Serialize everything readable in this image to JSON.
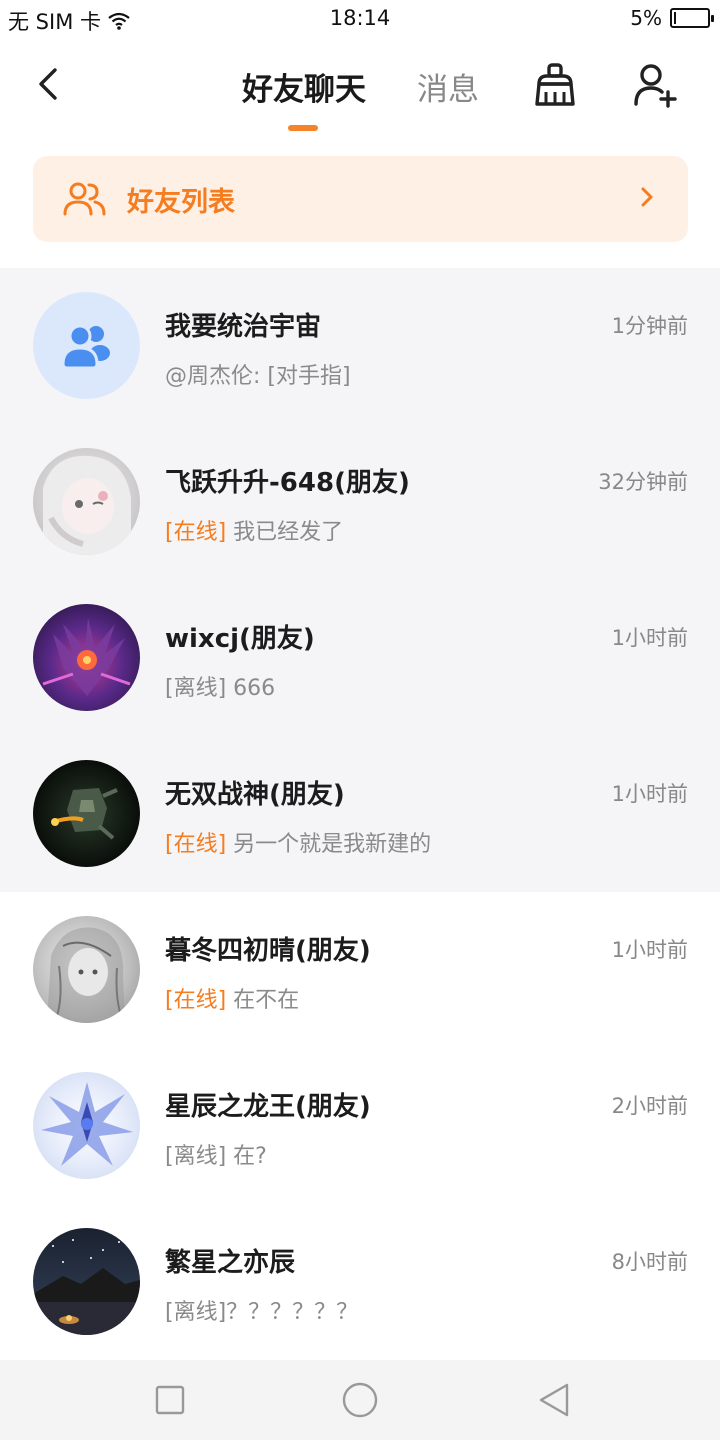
{
  "status_bar": {
    "carrier": "无 SIM 卡",
    "time": "18:14",
    "battery_text": "5%",
    "battery_level": 0.05
  },
  "header": {
    "active_tab": "好友聊天",
    "inactive_tab": "消息",
    "accent_color": "#f5832a"
  },
  "friend_banner": {
    "label": "好友列表"
  },
  "conversations": [
    {
      "name": "我要统治宇宙",
      "time": "1分钟前",
      "status": "",
      "message": "@周杰伦: [对手指]"
    },
    {
      "name": "飞跃升升-648(朋友)",
      "time": "32分钟前",
      "status": "[在线]",
      "message": " 我已经发了"
    },
    {
      "name": "wixcj(朋友)",
      "time": "1小时前",
      "status": "[离线]",
      "message": " 666"
    },
    {
      "name": "无双战神(朋友)",
      "time": "1小时前",
      "status": "[在线]",
      "message": " 另一个就是我新建的"
    },
    {
      "name": "暮冬四初晴(朋友)",
      "time": "1小时前",
      "status": "[在线]",
      "message": " 在不在"
    },
    {
      "name": "星辰之龙王(朋友)",
      "time": "2小时前",
      "status": "[离线]",
      "message": " 在?"
    },
    {
      "name": "繁星之亦辰",
      "time": "8小时前",
      "status": "[离线]",
      "message": "？？？？？？"
    }
  ]
}
